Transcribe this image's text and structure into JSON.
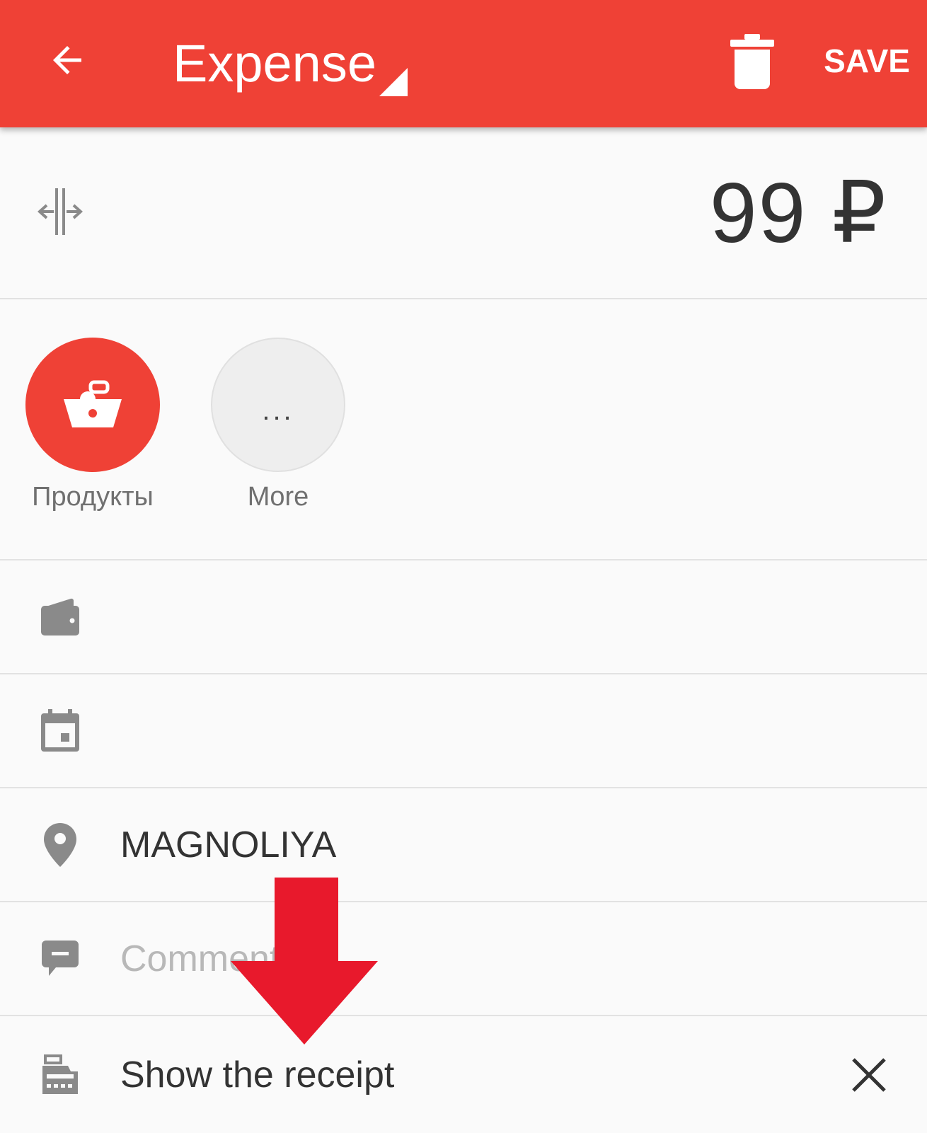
{
  "toolbar": {
    "title": "Expense",
    "save_label": "SAVE",
    "accent_color": "#ef4136"
  },
  "amount": {
    "value": "99 ₽"
  },
  "categories": [
    {
      "label": "Продукты",
      "icon": "basket-icon",
      "selected": true
    },
    {
      "label": "More",
      "icon": "more-icon",
      "symbol": "...",
      "selected": false
    }
  ],
  "fields": {
    "account": {
      "icon": "wallet-icon",
      "value": ""
    },
    "date": {
      "icon": "calendar-icon",
      "value": ""
    },
    "place": {
      "icon": "location-pin-icon",
      "value": "MAGNOLIYA"
    },
    "comment": {
      "icon": "comment-icon",
      "placeholder": "Comment"
    },
    "receipt": {
      "icon": "cash-register-icon",
      "label": "Show the receipt",
      "close_icon": "close-icon"
    }
  },
  "annotation": {
    "arrow_color": "#e8192c"
  }
}
